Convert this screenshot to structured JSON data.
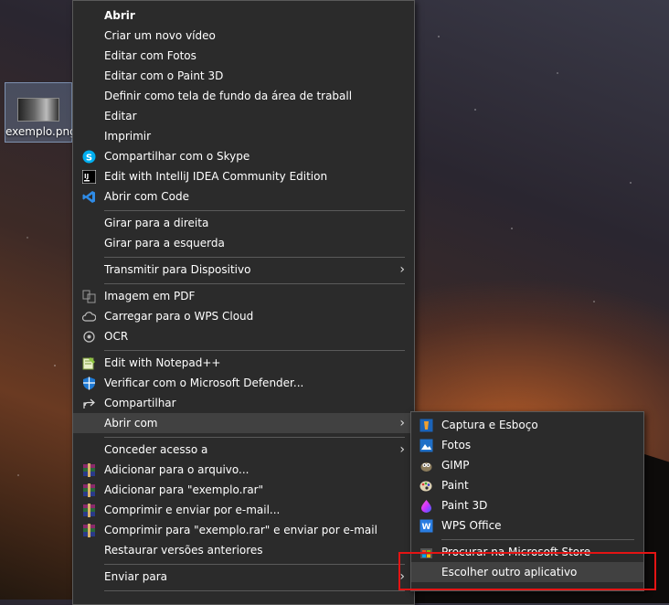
{
  "desktop": {
    "icon_label": "exemplo.png"
  },
  "main_menu": {
    "open": "Abrir",
    "new_video": "Criar um novo vídeo",
    "edit_photos": "Editar com Fotos",
    "edit_paint3d": "Editar com o Paint 3D",
    "set_wallpaper": "Definir como tela de fundo da área de traball",
    "edit": "Editar",
    "print": "Imprimir",
    "skype": "Compartilhar com o Skype",
    "intellij": "Edit with IntelliJ IDEA Community Edition",
    "vscode": "Abrir com Code",
    "rotate_right": "Girar para a direita",
    "rotate_left": "Girar para a esquerda",
    "cast": "Transmitir para Dispositivo",
    "pdf": "Imagem em PDF",
    "wps_cloud": "Carregar para o WPS Cloud",
    "ocr": "OCR",
    "notepadpp": "Edit with Notepad++",
    "defender": "Verificar com o Microsoft Defender...",
    "share": "Compartilhar",
    "open_with": "Abrir com",
    "grant_access": "Conceder acesso a",
    "add_archive": "Adicionar para o arquivo...",
    "add_rar": "Adicionar para \"exemplo.rar\"",
    "compress_email": "Comprimir e enviar por e-mail...",
    "compress_rar_email": "Comprimir para \"exemplo.rar\" e enviar por e-mail",
    "restore": "Restaurar versões anteriores",
    "send_to": "Enviar para"
  },
  "sub_menu": {
    "snip": "Captura e Esboço",
    "photos": "Fotos",
    "gimp": "GIMP",
    "paint": "Paint",
    "paint3d": "Paint 3D",
    "wps_office": "WPS Office",
    "store": "Procurar na Microsoft Store",
    "choose_other": "Escolher outro aplicativo"
  },
  "icons": {
    "skype": "skype-icon",
    "intellij": "intellij-icon",
    "vscode": "vscode-icon",
    "pdf": "pdf-icon",
    "cloud": "cloud-icon",
    "ocr": "ocr-icon",
    "notepadpp": "notepadpp-icon",
    "defender": "defender-icon",
    "share": "share-icon",
    "winrar": "winrar-icon",
    "chevron": "chevron-right-icon"
  },
  "colors": {
    "menu_bg": "#2b2b2b",
    "highlight": "#414141",
    "separator": "#5a5a5a",
    "annotation": "#e41414"
  }
}
